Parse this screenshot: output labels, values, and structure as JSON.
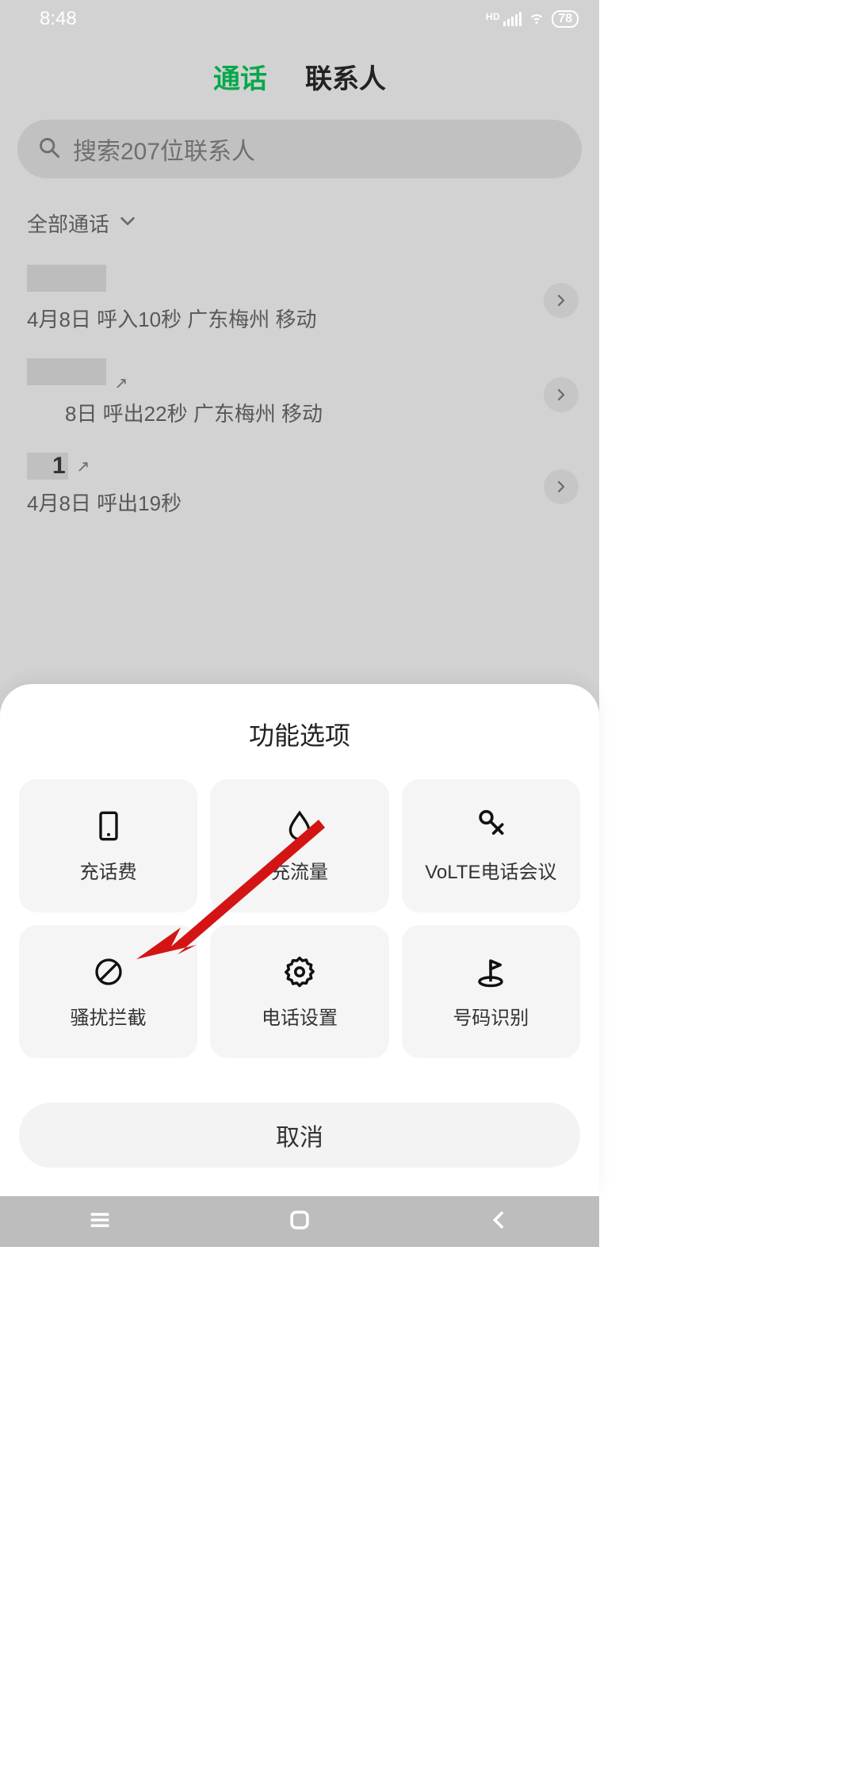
{
  "status": {
    "time": "8:48",
    "hd": "HD",
    "battery": "78"
  },
  "tabs": {
    "calls": "通话",
    "contacts": "联系人"
  },
  "search": {
    "placeholder": "搜索207位联系人"
  },
  "filter": {
    "label": "全部通话"
  },
  "calls": [
    {
      "name": "",
      "sub": "4月8日 呼入10秒 广东梅州 移动",
      "out": false
    },
    {
      "name": "",
      "sub": "8日 呼出22秒 广东梅州 移动",
      "out": true
    },
    {
      "name": "1",
      "sub": "4月8日 呼出19秒",
      "out": true
    }
  ],
  "sheet": {
    "title": "功能选项",
    "tiles": [
      {
        "icon": "phone-card",
        "label": "充话费"
      },
      {
        "icon": "droplet",
        "label": "充流量"
      },
      {
        "icon": "mic",
        "label": "VoLTE电话会议"
      },
      {
        "icon": "block",
        "label": "骚扰拦截"
      },
      {
        "icon": "gear",
        "label": "电话设置"
      },
      {
        "icon": "flag",
        "label": "号码识别"
      }
    ],
    "cancel": "取消"
  }
}
